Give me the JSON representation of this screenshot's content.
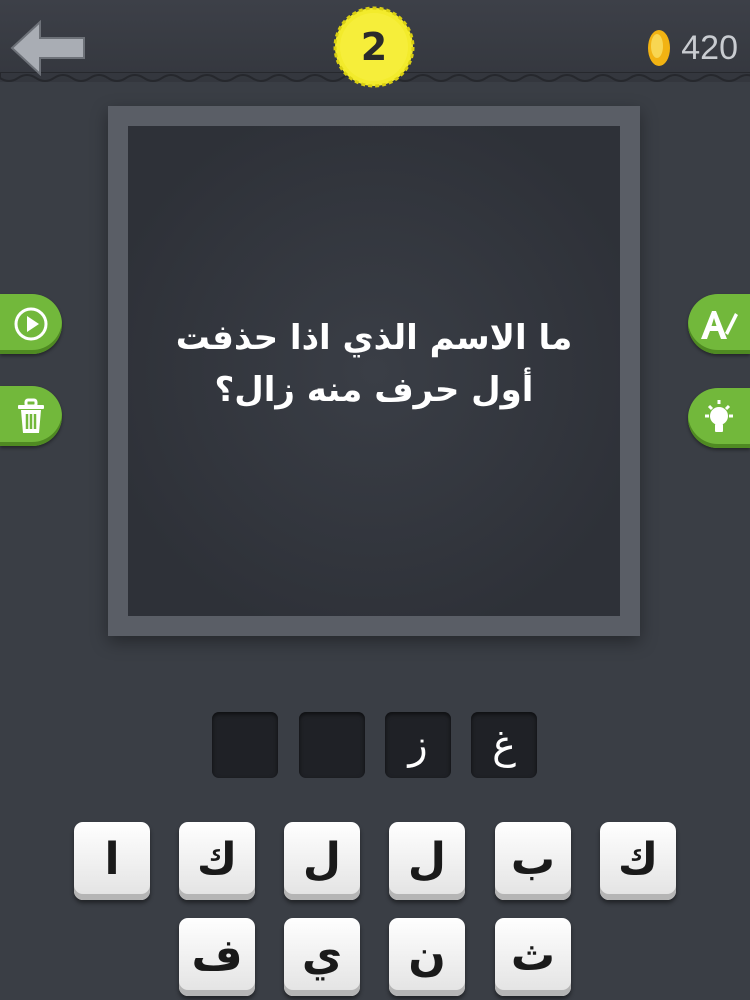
{
  "header": {
    "level": "2",
    "coins": "420",
    "back_icon": "back-arrow-icon",
    "coin_icon": "gold-coin-icon"
  },
  "puzzle": {
    "question_line_1": "ما الاسم الذي اذا حذفت",
    "question_line_2": "أول حرف منه زال؟"
  },
  "side_buttons": {
    "left": [
      "play-icon",
      "trash-icon"
    ],
    "right": [
      "remove-letter-icon",
      "lightbulb-hint-icon"
    ]
  },
  "answer_slots": [
    "",
    "",
    "ز",
    "غ"
  ],
  "keyboard": {
    "row1": [
      "ا",
      "ك",
      "ل",
      "ل",
      "ب",
      "ك"
    ],
    "row2": [
      "ف",
      "ي",
      "ن",
      "ث"
    ]
  },
  "colors": {
    "background": "#3a3e45",
    "accent_green": "#72b83b",
    "level_badge": "#f3eb2c",
    "coin_gold": "#f2b313",
    "key_face": "#ffffff"
  }
}
